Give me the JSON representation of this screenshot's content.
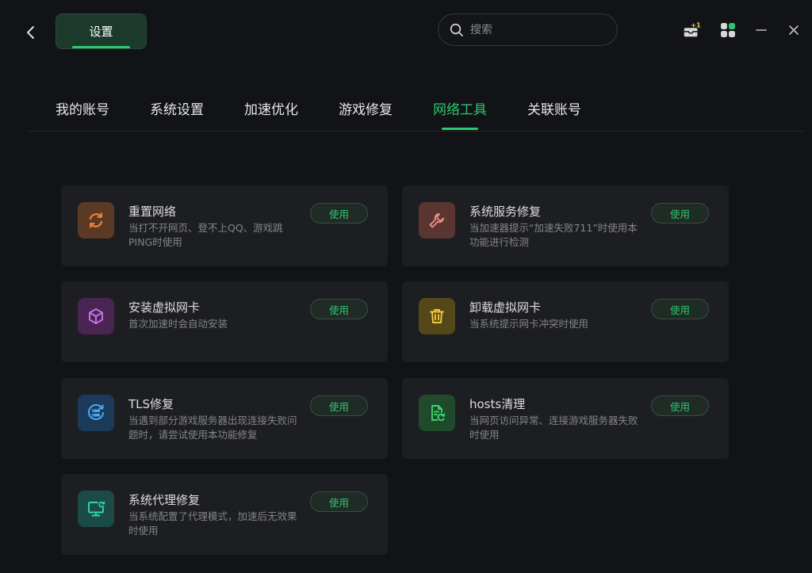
{
  "header": {
    "settings_label": "设置",
    "search_placeholder": "搜索",
    "badge": "+1"
  },
  "nav": {
    "tabs": [
      {
        "label": "我的账号"
      },
      {
        "label": "系统设置"
      },
      {
        "label": "加速优化"
      },
      {
        "label": "游戏修复"
      },
      {
        "label": "网络工具",
        "active": true
      },
      {
        "label": "关联账号"
      }
    ]
  },
  "tools": [
    {
      "title": "重置网络",
      "desc": "当打不开网页、登不上QQ、游戏跳PING时使用",
      "button": "使用",
      "icon": "refresh-icon",
      "color": "#f0833a"
    },
    {
      "title": "系统服务修复",
      "desc": "当加速器提示“加速失败711”时使用本功能进行检测",
      "button": "使用",
      "icon": "wrench-icon",
      "color": "#e88f85"
    },
    {
      "title": "安装虚拟网卡",
      "desc": "首次加速时会自动安装",
      "button": "使用",
      "icon": "cube-icon",
      "color": "#c774e8"
    },
    {
      "title": "卸载虚拟网卡",
      "desc": "当系统提示网卡冲突时使用",
      "button": "使用",
      "icon": "trash-icon",
      "color": "#f5c93c"
    },
    {
      "title": "TLS修复",
      "desc": "当遇到部分游戏服务器出现连接失败问题时，请尝试使用本功能修复",
      "button": "使用",
      "icon": "server-repair-icon",
      "color": "#4aa8f5"
    },
    {
      "title": "hosts清理",
      "desc": "当网页访问异常、连接游戏服务器失败时使用",
      "button": "使用",
      "icon": "file-clean-icon",
      "color": "#3fd06a"
    },
    {
      "title": "系统代理修复",
      "desc": "当系统配置了代理模式，加速后无效果时使用",
      "button": "使用",
      "icon": "monitor-icon",
      "color": "#2fd5b5"
    }
  ],
  "colors": {
    "accent": "#2fc771",
    "background": "#121316",
    "card": "#1d1e22"
  }
}
